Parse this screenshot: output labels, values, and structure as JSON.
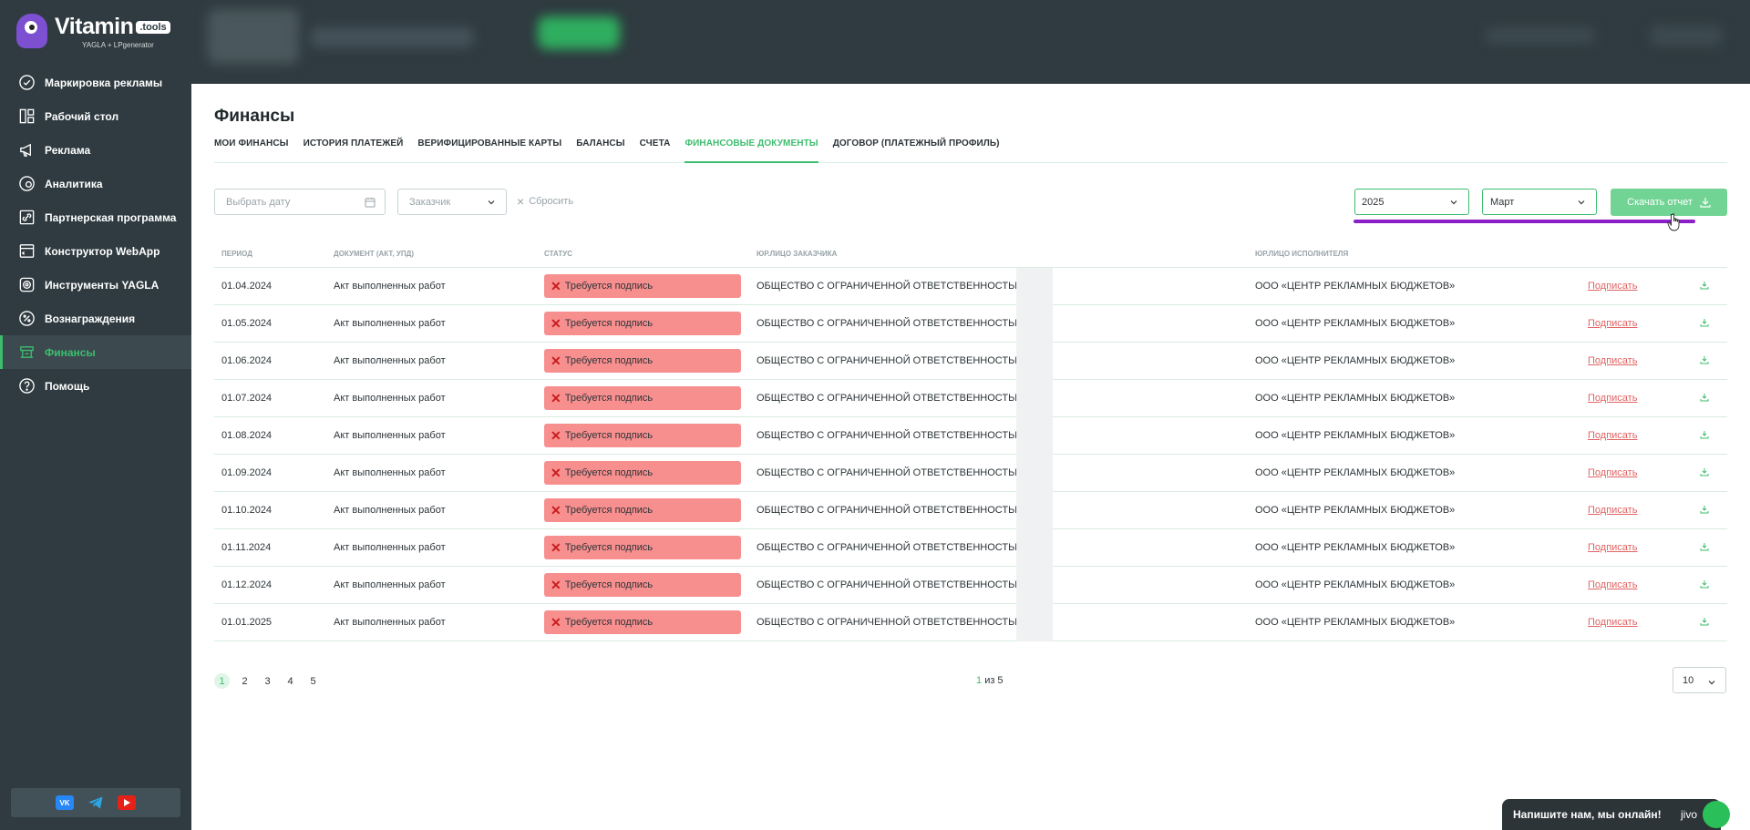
{
  "logo": {
    "name": "Vitamin",
    "badge": ".tools",
    "subtitle": "YAGLA + LPgenerator"
  },
  "sidebar": {
    "items": [
      {
        "label": "Маркировка рекламы",
        "icon": "check-circle-icon"
      },
      {
        "label": "Рабочий стол",
        "icon": "dashboard-icon"
      },
      {
        "label": "Реклама",
        "icon": "megaphone-icon"
      },
      {
        "label": "Аналитика",
        "icon": "analytics-icon"
      },
      {
        "label": "Партнерская программа",
        "icon": "link-icon"
      },
      {
        "label": "Конструктор WebApp",
        "icon": "webapp-icon"
      },
      {
        "label": "Инструменты YAGLA",
        "icon": "tools-icon"
      },
      {
        "label": "Вознаграждения",
        "icon": "reward-icon"
      },
      {
        "label": "Финансы",
        "icon": "finance-icon",
        "active": true
      },
      {
        "label": "Помощь",
        "icon": "help-icon"
      }
    ],
    "social": [
      "vk-icon",
      "telegram-icon",
      "youtube-icon"
    ]
  },
  "page": {
    "title": "Финансы",
    "tabs": [
      {
        "label": "МОИ ФИНАНСЫ"
      },
      {
        "label": "ИСТОРИЯ ПЛАТЕЖЕЙ"
      },
      {
        "label": "ВЕРИФИЦИРОВАННЫЕ КАРТЫ"
      },
      {
        "label": "БАЛАНСЫ"
      },
      {
        "label": "СЧЕТА"
      },
      {
        "label": "ФИНАНСОВЫЕ ДОКУМЕНТЫ",
        "active": true
      },
      {
        "label": "ДОГОВОР (ПЛАТЕЖНЫЙ ПРОФИЛЬ)"
      }
    ]
  },
  "filters": {
    "date_placeholder": "Выбрать дату",
    "customer_placeholder": "Заказчик",
    "reset_label": "Сбросить",
    "year_value": "2025",
    "month_value": "Март",
    "download_label": "Скачать отчет"
  },
  "table": {
    "headers": [
      "ПЕРИОД",
      "ДОКУМЕНТ (АКТ, УПД)",
      "СТАТУС",
      "ЮР.ЛИЦО ЗАКАЗЧИКА",
      "ЮР.ЛИЦО ИСПОЛНИТЕЛЯ"
    ],
    "rows": [
      {
        "period": "01.04.2024",
        "doc": "Акт выполненных работ",
        "status": "Требуется подпись",
        "customer": "ОБЩЕСТВО С ОГРАНИЧЕННОЙ ОТВЕТСТВЕННОСТЬЮ",
        "executor": "ООО «ЦЕНТР РЕКЛАМНЫХ БЮДЖЕТОВ»",
        "action": "Подписать"
      },
      {
        "period": "01.05.2024",
        "doc": "Акт выполненных работ",
        "status": "Требуется подпись",
        "customer": "ОБЩЕСТВО С ОГРАНИЧЕННОЙ ОТВЕТСТВЕННОСТЬЮ",
        "executor": "ООО «ЦЕНТР РЕКЛАМНЫХ БЮДЖЕТОВ»",
        "action": "Подписать"
      },
      {
        "period": "01.06.2024",
        "doc": "Акт выполненных работ",
        "status": "Требуется подпись",
        "customer": "ОБЩЕСТВО С ОГРАНИЧЕННОЙ ОТВЕТСТВЕННОСТЬЮ",
        "executor": "ООО «ЦЕНТР РЕКЛАМНЫХ БЮДЖЕТОВ»",
        "action": "Подписать"
      },
      {
        "period": "01.07.2024",
        "doc": "Акт выполненных работ",
        "status": "Требуется подпись",
        "customer": "ОБЩЕСТВО С ОГРАНИЧЕННОЙ ОТВЕТСТВЕННОСТЬЮ",
        "executor": "ООО «ЦЕНТР РЕКЛАМНЫХ БЮДЖЕТОВ»",
        "action": "Подписать"
      },
      {
        "period": "01.08.2024",
        "doc": "Акт выполненных работ",
        "status": "Требуется подпись",
        "customer": "ОБЩЕСТВО С ОГРАНИЧЕННОЙ ОТВЕТСТВЕННОСТЬЮ",
        "executor": "ООО «ЦЕНТР РЕКЛАМНЫХ БЮДЖЕТОВ»",
        "action": "Подписать"
      },
      {
        "period": "01.09.2024",
        "doc": "Акт выполненных работ",
        "status": "Требуется подпись",
        "customer": "ОБЩЕСТВО С ОГРАНИЧЕННОЙ ОТВЕТСТВЕННОСТЬЮ",
        "executor": "ООО «ЦЕНТР РЕКЛАМНЫХ БЮДЖЕТОВ»",
        "action": "Подписать"
      },
      {
        "period": "01.10.2024",
        "doc": "Акт выполненных работ",
        "status": "Требуется подпись",
        "customer": "ОБЩЕСТВО С ОГРАНИЧЕННОЙ ОТВЕТСТВЕННОСТЬЮ",
        "executor": "ООО «ЦЕНТР РЕКЛАМНЫХ БЮДЖЕТОВ»",
        "action": "Подписать"
      },
      {
        "period": "01.11.2024",
        "doc": "Акт выполненных работ",
        "status": "Требуется подпись",
        "customer": "ОБЩЕСТВО С ОГРАНИЧЕННОЙ ОТВЕТСТВЕННОСТЬЮ",
        "executor": "ООО «ЦЕНТР РЕКЛАМНЫХ БЮДЖЕТОВ»",
        "action": "Подписать"
      },
      {
        "period": "01.12.2024",
        "doc": "Акт выполненных работ",
        "status": "Требуется подпись",
        "customer": "ОБЩЕСТВО С ОГРАНИЧЕННОЙ ОТВЕТСТВЕННОСТЬЮ",
        "executor": "ООО «ЦЕНТР РЕКЛАМНЫХ БЮДЖЕТОВ»",
        "action": "Подписать"
      },
      {
        "period": "01.01.2025",
        "doc": "Акт выполненных работ",
        "status": "Требуется подпись",
        "customer": "ОБЩЕСТВО С ОГРАНИЧЕННОЙ ОТВЕТСТВЕННОСТЬЮ",
        "executor": "ООО «ЦЕНТР РЕКЛАМНЫХ БЮДЖЕТОВ»",
        "action": "Подписать"
      }
    ]
  },
  "pagination": {
    "pages": [
      "1",
      "2",
      "3",
      "4",
      "5"
    ],
    "current": "1",
    "of_label": "из 5",
    "per_page": "10"
  },
  "chat": {
    "label": "Напишите нам, мы онлайн!",
    "brand": "jivo"
  },
  "colors": {
    "accent": "#3dbd6e",
    "sidebar": "#2f3b40",
    "status_bg": "#f88f8f",
    "highlight": "#8b1ec7"
  }
}
